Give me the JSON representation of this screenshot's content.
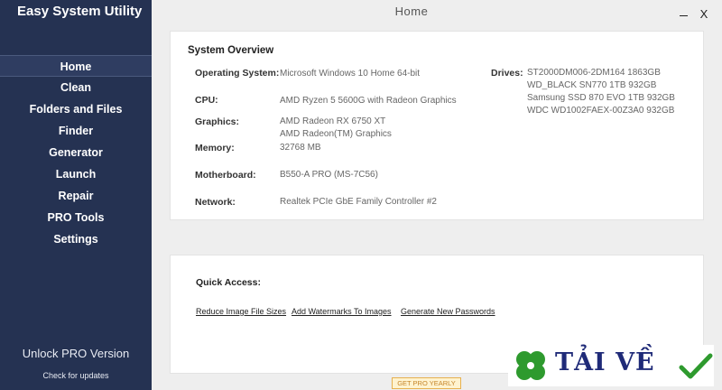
{
  "app": {
    "title": "Easy System Utility"
  },
  "header": {
    "title": "Home",
    "minimize_label": "",
    "close_label": "X"
  },
  "sidebar": {
    "items": [
      {
        "label": "Home",
        "active": true
      },
      {
        "label": "Clean"
      },
      {
        "label": "Folders and Files"
      },
      {
        "label": "Finder"
      },
      {
        "label": "Generator"
      },
      {
        "label": "Launch"
      },
      {
        "label": "Repair"
      },
      {
        "label": "PRO Tools"
      },
      {
        "label": "Settings"
      }
    ],
    "unlock_label": "Unlock PRO Version",
    "updates_label": "Check for updates"
  },
  "overview": {
    "heading": "System Overview",
    "os_label": "Operating System:",
    "os_value": "Microsoft Windows 10 Home 64-bit",
    "cpu_label": "CPU:",
    "cpu_value": "AMD Ryzen 5 5600G with Radeon Graphics",
    "graphics_label": "Graphics:",
    "graphics_values": [
      "AMD Radeon RX 6750 XT",
      "AMD Radeon(TM) Graphics"
    ],
    "memory_label": "Memory:",
    "memory_value": "32768 MB",
    "motherboard_label": "Motherboard:",
    "motherboard_value": "B550-A PRO (MS-7C56)",
    "network_label": "Network:",
    "network_value": "Realtek PCIe GbE Family Controller #2",
    "drives_label": "Drives:",
    "drives_values": [
      "ST2000DM006-2DM164 1863GB",
      "WD_BLACK SN770 1TB 932GB",
      "Samsung SSD 870 EVO 1TB 932GB",
      "WDC WD1002FAEX-00Z3A0 932GB"
    ]
  },
  "quick_access": {
    "heading": "Quick Access:",
    "links": [
      "Reduce Image File Sizes",
      "Add Watermarks To Images",
      "Generate New Passwords"
    ]
  },
  "pro_yearly_label": "GET PRO YEARLY",
  "watermark": {
    "text": "TẢI VỀ",
    "leaf_color": "#2e9a2e",
    "check_color": "#2e9a2e"
  },
  "colors": {
    "sidebar": "#253252",
    "accent": "#e6b04f"
  }
}
